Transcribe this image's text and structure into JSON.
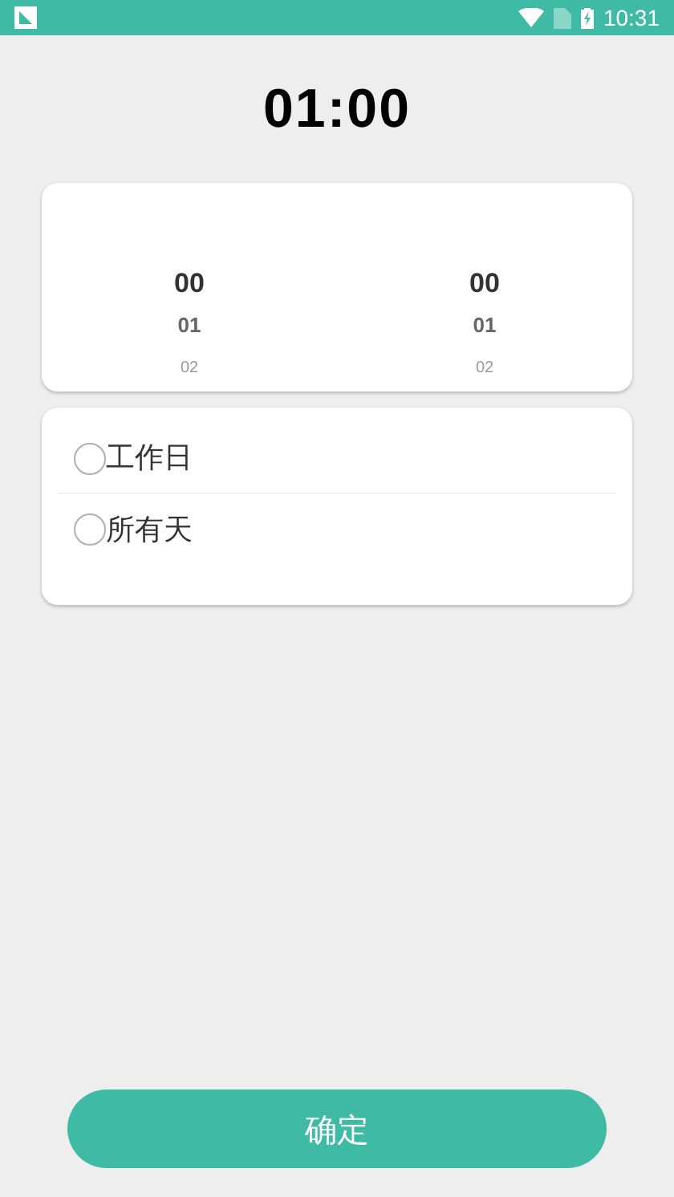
{
  "status_bar": {
    "time": "10:31"
  },
  "title": "01:00",
  "picker": {
    "columns": [
      {
        "items": [
          {
            "value": "00",
            "selected": true
          },
          {
            "value": "01",
            "selected": false
          },
          {
            "value": "02",
            "selected": false
          }
        ]
      },
      {
        "items": [
          {
            "value": "00",
            "selected": true
          },
          {
            "value": "01",
            "selected": false
          },
          {
            "value": "02",
            "selected": false
          }
        ]
      }
    ]
  },
  "options": [
    {
      "label": "工作日",
      "checked": false
    },
    {
      "label": "所有天",
      "checked": false
    }
  ],
  "confirm_button": "确定"
}
